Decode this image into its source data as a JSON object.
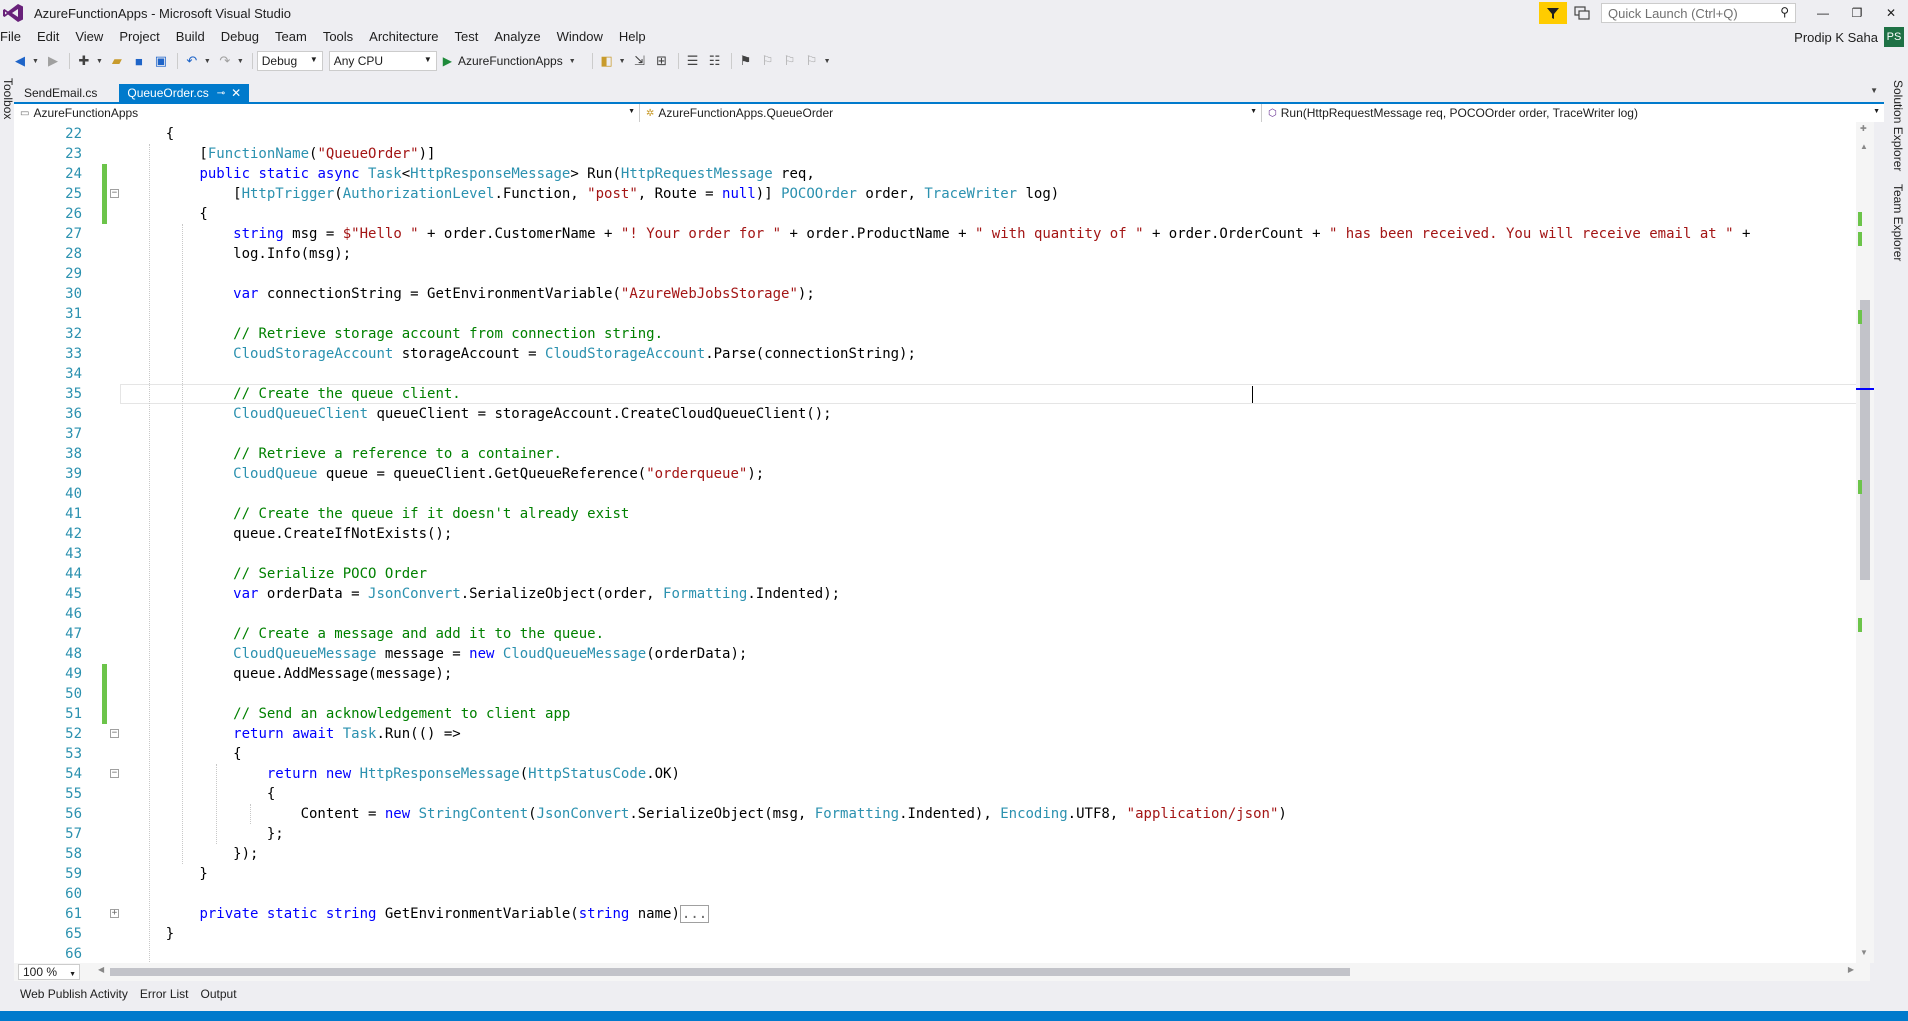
{
  "window": {
    "title": "AzureFunctionApps - Microsoft Visual Studio"
  },
  "quick_launch": {
    "placeholder": "Quick Launch (Ctrl+Q)"
  },
  "menu": [
    "File",
    "Edit",
    "View",
    "Project",
    "Build",
    "Debug",
    "Team",
    "Tools",
    "Architecture",
    "Test",
    "Analyze",
    "Window",
    "Help"
  ],
  "user": {
    "name": "Prodip K Saha",
    "initials": "PS"
  },
  "toolbar": {
    "configuration": "Debug",
    "platform": "Any CPU",
    "start_target": "AzureFunctionApps"
  },
  "side_left": {
    "toolbox": "Toolbox"
  },
  "side_right": {
    "solution_explorer": "Solution Explorer",
    "team_explorer": "Team Explorer"
  },
  "tabs": [
    {
      "label": "SendEmail.cs"
    },
    {
      "label": "QueueOrder.cs"
    }
  ],
  "navbar": {
    "project": "AzureFunctionApps",
    "type": "AzureFunctionApps.QueueOrder",
    "member": "Run(HttpRequestMessage req, POCOOrder order, TraceWriter log)"
  },
  "code_lines": [
    {
      "n": "22",
      "t": [
        [
          "p",
          "    {"
        ]
      ]
    },
    {
      "n": "23",
      "t": [
        [
          "p",
          "        ["
        ],
        [
          "ty",
          "FunctionName"
        ],
        [
          "p",
          "("
        ],
        [
          "st",
          "\"QueueOrder\""
        ],
        [
          "p",
          ")]"
        ]
      ]
    },
    {
      "n": "24",
      "t": [
        [
          "p",
          "        "
        ],
        [
          "kw",
          "public static async "
        ],
        [
          "ty",
          "Task"
        ],
        [
          "p",
          "<"
        ],
        [
          "ty",
          "HttpResponseMessage"
        ],
        [
          "p",
          "> Run("
        ],
        [
          "ty",
          "HttpRequestMessage"
        ],
        [
          "p",
          " req,"
        ]
      ]
    },
    {
      "n": "25",
      "t": [
        [
          "p",
          "            ["
        ],
        [
          "ty",
          "HttpTrigger"
        ],
        [
          "p",
          "("
        ],
        [
          "ty",
          "AuthorizationLevel"
        ],
        [
          "p",
          ".Function, "
        ],
        [
          "st",
          "\"post\""
        ],
        [
          "p",
          ", Route = "
        ],
        [
          "kw",
          "null"
        ],
        [
          "p",
          ")] "
        ],
        [
          "ty",
          "POCOOrder"
        ],
        [
          "p",
          " order, "
        ],
        [
          "ty",
          "TraceWriter"
        ],
        [
          "p",
          " log)"
        ]
      ]
    },
    {
      "n": "26",
      "t": [
        [
          "p",
          "        {"
        ]
      ]
    },
    {
      "n": "27",
      "t": [
        [
          "p",
          "            "
        ],
        [
          "kw",
          "string"
        ],
        [
          "p",
          " msg = "
        ],
        [
          "st",
          "$\"Hello \""
        ],
        [
          "p",
          " + order.CustomerName + "
        ],
        [
          "st",
          "\"! Your order for \""
        ],
        [
          "p",
          " + order.ProductName + "
        ],
        [
          "st",
          "\" with quantity of \""
        ],
        [
          "p",
          " + order.OrderCount + "
        ],
        [
          "st",
          "\" has been received. You will receive email at \""
        ],
        [
          "p",
          " +"
        ]
      ]
    },
    {
      "n": "28",
      "t": [
        [
          "p",
          "            log.Info(msg);"
        ]
      ]
    },
    {
      "n": "29",
      "t": [
        [
          "p",
          ""
        ]
      ]
    },
    {
      "n": "30",
      "t": [
        [
          "p",
          "            "
        ],
        [
          "kw",
          "var"
        ],
        [
          "p",
          " connectionString = GetEnvironmentVariable("
        ],
        [
          "st",
          "\"AzureWebJobsStorage\""
        ],
        [
          "p",
          ");"
        ]
      ]
    },
    {
      "n": "31",
      "t": [
        [
          "p",
          ""
        ]
      ]
    },
    {
      "n": "32",
      "t": [
        [
          "p",
          "            "
        ],
        [
          "cm",
          "// Retrieve storage account from connection string."
        ]
      ]
    },
    {
      "n": "33",
      "t": [
        [
          "p",
          "            "
        ],
        [
          "ty",
          "CloudStorageAccount"
        ],
        [
          "p",
          " storageAccount = "
        ],
        [
          "ty",
          "CloudStorageAccount"
        ],
        [
          "p",
          ".Parse(connectionString);"
        ]
      ]
    },
    {
      "n": "34",
      "t": [
        [
          "p",
          ""
        ]
      ]
    },
    {
      "n": "35",
      "t": [
        [
          "p",
          "            "
        ],
        [
          "cm",
          "// Create the queue client."
        ]
      ]
    },
    {
      "n": "36",
      "t": [
        [
          "p",
          "            "
        ],
        [
          "ty",
          "CloudQueueClient"
        ],
        [
          "p",
          " queueClient = storageAccount.CreateCloudQueueClient();"
        ]
      ]
    },
    {
      "n": "37",
      "t": [
        [
          "p",
          ""
        ]
      ]
    },
    {
      "n": "38",
      "t": [
        [
          "p",
          "            "
        ],
        [
          "cm",
          "// Retrieve a reference to a container."
        ]
      ]
    },
    {
      "n": "39",
      "t": [
        [
          "p",
          "            "
        ],
        [
          "ty",
          "CloudQueue"
        ],
        [
          "p",
          " queue = queueClient.GetQueueReference("
        ],
        [
          "st",
          "\"orderqueue\""
        ],
        [
          "p",
          ");"
        ]
      ]
    },
    {
      "n": "40",
      "t": [
        [
          "p",
          ""
        ]
      ]
    },
    {
      "n": "41",
      "t": [
        [
          "p",
          "            "
        ],
        [
          "cm",
          "// Create the queue if it doesn't already exist"
        ]
      ]
    },
    {
      "n": "42",
      "t": [
        [
          "p",
          "            queue.CreateIfNotExists();"
        ]
      ]
    },
    {
      "n": "43",
      "t": [
        [
          "p",
          ""
        ]
      ]
    },
    {
      "n": "44",
      "t": [
        [
          "p",
          "            "
        ],
        [
          "cm",
          "// Serialize POCO Order"
        ]
      ]
    },
    {
      "n": "45",
      "t": [
        [
          "p",
          "            "
        ],
        [
          "kw",
          "var"
        ],
        [
          "p",
          " orderData = "
        ],
        [
          "ty",
          "JsonConvert"
        ],
        [
          "p",
          ".SerializeObject(order, "
        ],
        [
          "ty",
          "Formatting"
        ],
        [
          "p",
          ".Indented);"
        ]
      ]
    },
    {
      "n": "46",
      "t": [
        [
          "p",
          ""
        ]
      ]
    },
    {
      "n": "47",
      "t": [
        [
          "p",
          "            "
        ],
        [
          "cm",
          "// Create a message and add it to the queue."
        ]
      ]
    },
    {
      "n": "48",
      "t": [
        [
          "p",
          "            "
        ],
        [
          "ty",
          "CloudQueueMessage"
        ],
        [
          "p",
          " message = "
        ],
        [
          "kw",
          "new "
        ],
        [
          "ty",
          "CloudQueueMessage"
        ],
        [
          "p",
          "(orderData);"
        ]
      ]
    },
    {
      "n": "49",
      "t": [
        [
          "p",
          "            queue.AddMessage(message);"
        ]
      ]
    },
    {
      "n": "50",
      "t": [
        [
          "p",
          ""
        ]
      ]
    },
    {
      "n": "51",
      "t": [
        [
          "p",
          "            "
        ],
        [
          "cm",
          "// Send an acknowledgement to client app"
        ]
      ]
    },
    {
      "n": "52",
      "t": [
        [
          "p",
          "            "
        ],
        [
          "kw",
          "return await "
        ],
        [
          "ty",
          "Task"
        ],
        [
          "p",
          ".Run(() =>"
        ]
      ]
    },
    {
      "n": "53",
      "t": [
        [
          "p",
          "            {"
        ]
      ]
    },
    {
      "n": "54",
      "t": [
        [
          "p",
          "                "
        ],
        [
          "kw",
          "return new "
        ],
        [
          "ty",
          "HttpResponseMessage"
        ],
        [
          "p",
          "("
        ],
        [
          "ty",
          "HttpStatusCode"
        ],
        [
          "p",
          ".OK)"
        ]
      ]
    },
    {
      "n": "55",
      "t": [
        [
          "p",
          "                {"
        ]
      ]
    },
    {
      "n": "56",
      "t": [
        [
          "p",
          "                    Content = "
        ],
        [
          "kw",
          "new "
        ],
        [
          "ty",
          "StringContent"
        ],
        [
          "p",
          "("
        ],
        [
          "ty",
          "JsonConvert"
        ],
        [
          "p",
          ".SerializeObject(msg, "
        ],
        [
          "ty",
          "Formatting"
        ],
        [
          "p",
          ".Indented), "
        ],
        [
          "ty",
          "Encoding"
        ],
        [
          "p",
          ".UTF8, "
        ],
        [
          "st",
          "\"application/json\""
        ],
        [
          "p",
          ")"
        ]
      ]
    },
    {
      "n": "57",
      "t": [
        [
          "p",
          "                };"
        ]
      ]
    },
    {
      "n": "58",
      "t": [
        [
          "p",
          "            });"
        ]
      ]
    },
    {
      "n": "59",
      "t": [
        [
          "p",
          "        }"
        ]
      ]
    },
    {
      "n": "60",
      "t": [
        [
          "p",
          ""
        ]
      ]
    },
    {
      "n": "61",
      "t": [
        [
          "p",
          "        "
        ],
        [
          "kw",
          "private static string "
        ],
        [
          "p",
          "GetEnvironmentVariable("
        ],
        [
          "kw",
          "string"
        ],
        [
          "p",
          " name)"
        ],
        [
          "box",
          "..."
        ]
      ]
    },
    {
      "n": "65",
      "t": [
        [
          "p",
          "    }"
        ]
      ]
    },
    {
      "n": "66",
      "t": [
        [
          "p",
          ""
        ]
      ]
    }
  ],
  "zoom": {
    "value": "100 %"
  },
  "tool_tabs": [
    "Web Publish Activity",
    "Error List",
    "Output"
  ]
}
